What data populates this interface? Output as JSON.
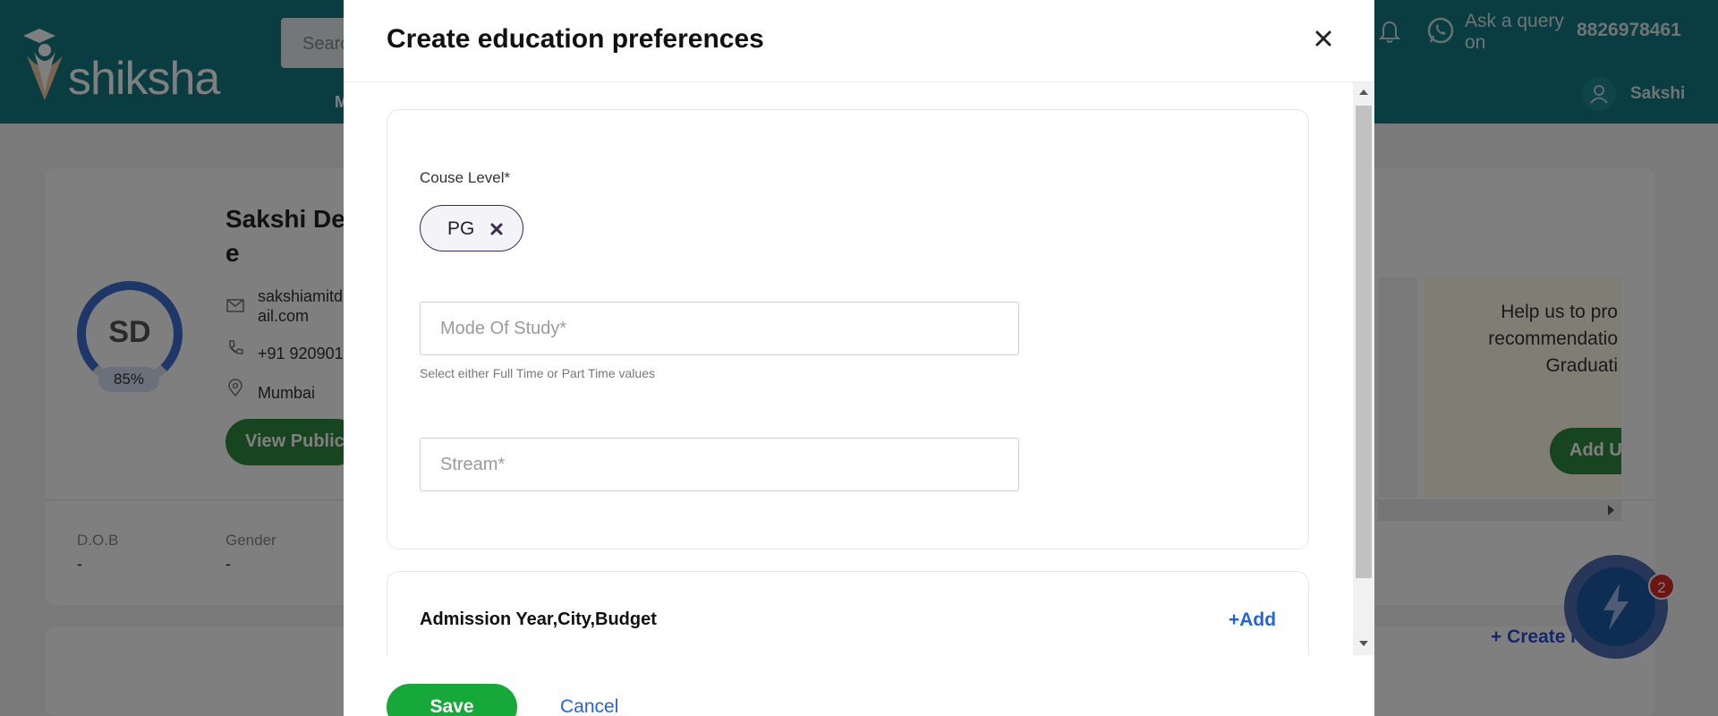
{
  "header": {
    "logo_text": "shiksha",
    "search_placeholder": "Searc",
    "nav_fragment": "M",
    "ask_query": "Ask a query on",
    "phone": "8826978461",
    "user_name": "Sakshi"
  },
  "profile": {
    "name": "Sakshi De e",
    "initials": "SD",
    "completion": "85%",
    "email": "sakshiamitd ail.com",
    "phone": "+91 920901",
    "city": "Mumbai",
    "view_button": "View Public",
    "dob_label": "D.O.B",
    "dob_value": "-",
    "gender_label": "Gender",
    "gender_value": "-",
    "recommendation_text": "Help us to pro recommendatio Graduati",
    "add_button": "Add U",
    "create_new": "+ Create Ne",
    "chat_badge": "2"
  },
  "modal": {
    "title": "Create education preferences",
    "close_icon": "close-icon",
    "course_level_label": "Couse Level*",
    "selected_chip": "PG",
    "mode_of_study_placeholder": "Mode Of Study*",
    "mode_hint": "Select either Full Time or Part Time values",
    "stream_placeholder": "Stream*",
    "section2_title": "Admission Year,City,Budget",
    "section2_add": "+Add",
    "save_label": "Save",
    "cancel_label": "Cancel"
  },
  "colors": {
    "header_bg": "#127b83",
    "save_green": "#17a83a",
    "link_blue": "#2563d8",
    "overlay": "rgba(0,0,0,0.5)"
  }
}
